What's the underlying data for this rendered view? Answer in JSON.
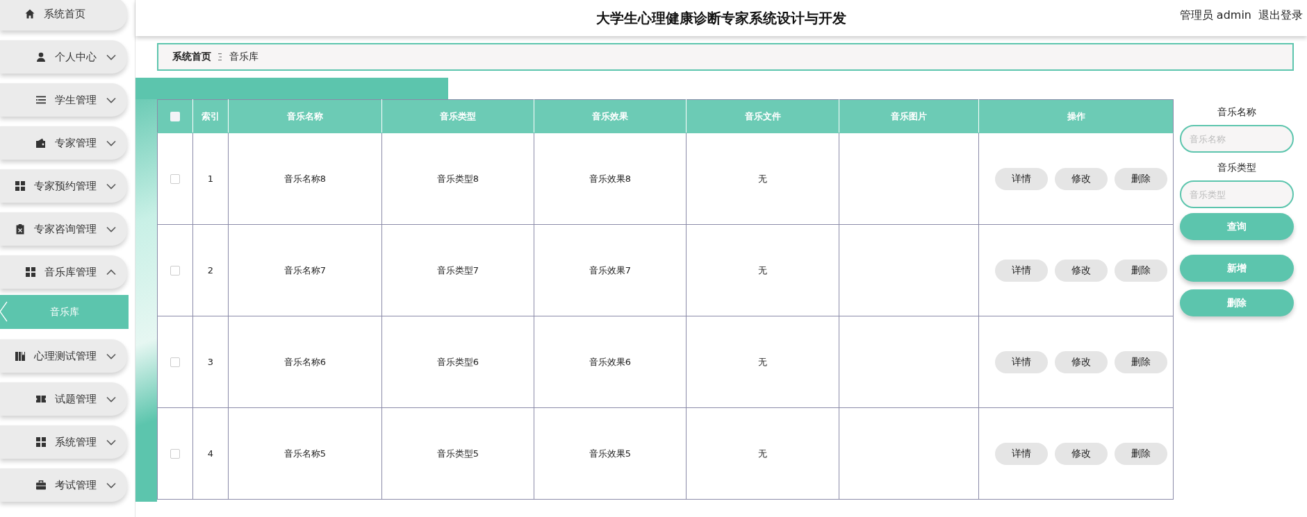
{
  "sidebar": {
    "items": [
      {
        "label": "系统首页",
        "kind": "link"
      },
      {
        "label": "个人中心",
        "kind": "menu",
        "expanded": false
      },
      {
        "label": "学生管理",
        "kind": "menu",
        "expanded": false
      },
      {
        "label": "专家管理",
        "kind": "menu",
        "expanded": false
      },
      {
        "label": "专家预约管理",
        "kind": "menu",
        "expanded": false
      },
      {
        "label": "专家咨询管理",
        "kind": "menu",
        "expanded": false
      },
      {
        "label": "音乐库管理",
        "kind": "menu",
        "expanded": true,
        "children": [
          {
            "label": "音乐库",
            "selected": true
          }
        ]
      },
      {
        "label": "心理测试管理",
        "kind": "menu",
        "expanded": false
      },
      {
        "label": "试题管理",
        "kind": "menu",
        "expanded": false
      },
      {
        "label": "系统管理",
        "kind": "menu",
        "expanded": false
      },
      {
        "label": "考试管理",
        "kind": "menu",
        "expanded": false
      }
    ]
  },
  "header": {
    "title": "大学生心理健康诊断专家系统设计与开发",
    "user": "管理员 admin",
    "logout": "退出登录"
  },
  "breadcrumb": [
    "系统首页",
    "音乐库"
  ],
  "table": {
    "columns": [
      "索引",
      "音乐名称",
      "音乐类型",
      "音乐效果",
      "音乐文件",
      "音乐图片",
      "操作"
    ],
    "select_all": false,
    "rows": [
      {
        "checked": false,
        "cells": [
          "1",
          "音乐名称8",
          "音乐类型8",
          "音乐效果8",
          "无"
        ],
        "actions": [
          "详情",
          "修改",
          "删除"
        ]
      },
      {
        "checked": false,
        "cells": [
          "2",
          "音乐名称7",
          "音乐类型7",
          "音乐效果7",
          "无"
        ],
        "actions": [
          "详情",
          "修改",
          "删除"
        ]
      },
      {
        "checked": false,
        "cells": [
          "3",
          "音乐名称6",
          "音乐类型6",
          "音乐效果6",
          "无"
        ],
        "actions": [
          "详情",
          "修改",
          "删除"
        ]
      },
      {
        "checked": false,
        "cells": [
          "4",
          "音乐名称5",
          "音乐类型5",
          "音乐效果5",
          "无"
        ],
        "actions": [
          "详情",
          "修改",
          "删除"
        ]
      }
    ]
  },
  "search": {
    "fields": [
      {
        "label": "音乐名称",
        "placeholder": "音乐名称"
      },
      {
        "label": "音乐类型",
        "placeholder": "音乐类型"
      }
    ],
    "query_button": "查询",
    "buttons": [
      "新增",
      "删除"
    ]
  }
}
